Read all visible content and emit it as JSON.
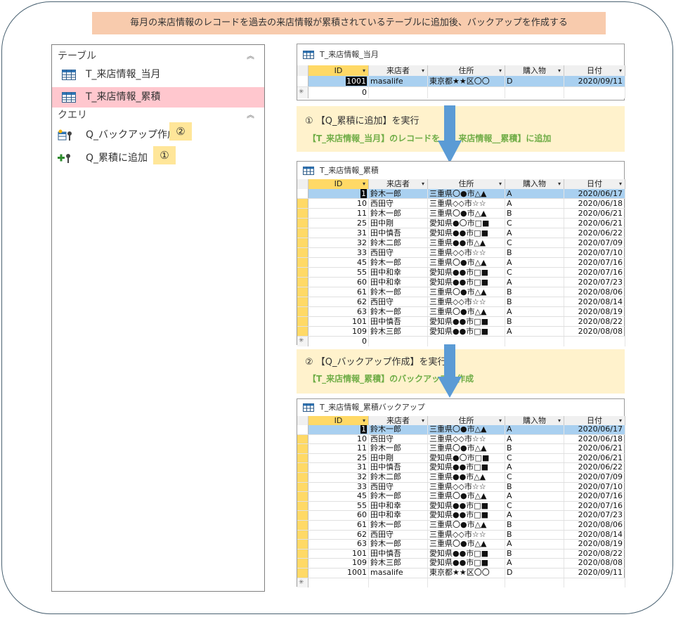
{
  "banner": "毎月の来店情報のレコードを過去の来店情報が累積されているテーブルに追加後、バックアップを作成する",
  "nav": {
    "tables_header": "テーブル",
    "queries_header": "クエリ",
    "collapse_icon": "double-chevron-up",
    "tables": [
      {
        "label": "T_来店情報_当月",
        "icon": "table-icon"
      },
      {
        "label": "T_来店情報_累積",
        "icon": "table-icon",
        "selected": true
      }
    ],
    "queries": [
      {
        "label": "Q_バックアップ作成",
        "icon": "make-table-query-icon",
        "badge": "②"
      },
      {
        "label": "Q_累積に追加",
        "icon": "append-query-icon",
        "badge": "①"
      }
    ]
  },
  "columns": [
    "ID",
    "来店者",
    "住所",
    "購入物",
    "日付"
  ],
  "sheet_monthly": {
    "title": "T_来店情報_当月",
    "rows": [
      {
        "id": "1001",
        "name": "masalife",
        "addr": "東京都★★区〇〇",
        "item": "D",
        "date": "2020/09/11"
      }
    ],
    "new_row_id": "0"
  },
  "step1": {
    "line1": "① 【Q_累積に追加】を実行",
    "line2": "【T_来店情報_当月】のレコードを【T_来店情報__累積】に追加"
  },
  "sheet_cumulative": {
    "title": "T_来店情報_累積",
    "rows": [
      {
        "id": "1",
        "name": "鈴木一郎",
        "addr": "三重県〇●市△▲",
        "item": "A",
        "date": "2020/06/17"
      },
      {
        "id": "10",
        "name": "西田守",
        "addr": "三重県◇◇市☆☆",
        "item": "A",
        "date": "2020/06/18"
      },
      {
        "id": "11",
        "name": "鈴木一郎",
        "addr": "三重県〇●市△▲",
        "item": "B",
        "date": "2020/06/21"
      },
      {
        "id": "25",
        "name": "田中剛",
        "addr": "愛知県●〇市□■",
        "item": "C",
        "date": "2020/06/21"
      },
      {
        "id": "31",
        "name": "田中慎吾",
        "addr": "愛知県●●市□■",
        "item": "A",
        "date": "2020/06/22"
      },
      {
        "id": "32",
        "name": "鈴木二郎",
        "addr": "三重県●●市△▲",
        "item": "C",
        "date": "2020/07/09"
      },
      {
        "id": "33",
        "name": "西田守",
        "addr": "三重県◇◇市☆☆",
        "item": "B",
        "date": "2020/07/10"
      },
      {
        "id": "45",
        "name": "鈴木一郎",
        "addr": "三重県〇●市△▲",
        "item": "A",
        "date": "2020/07/16"
      },
      {
        "id": "55",
        "name": "田中和幸",
        "addr": "愛知県●●市□■",
        "item": "C",
        "date": "2020/07/16"
      },
      {
        "id": "60",
        "name": "田中和幸",
        "addr": "愛知県●●市□■",
        "item": "A",
        "date": "2020/07/23"
      },
      {
        "id": "61",
        "name": "鈴木一郎",
        "addr": "三重県〇●市△▲",
        "item": "B",
        "date": "2020/08/06"
      },
      {
        "id": "62",
        "name": "西田守",
        "addr": "三重県◇◇市☆☆",
        "item": "B",
        "date": "2020/08/14"
      },
      {
        "id": "63",
        "name": "鈴木一郎",
        "addr": "三重県〇●市△▲",
        "item": "A",
        "date": "2020/08/19"
      },
      {
        "id": "101",
        "name": "田中慎吾",
        "addr": "愛知県●●市□■",
        "item": "B",
        "date": "2020/08/22"
      },
      {
        "id": "109",
        "name": "鈴木三郎",
        "addr": "愛知県●●市□■",
        "item": "A",
        "date": "2020/08/08"
      }
    ],
    "new_row_id": "0"
  },
  "step2": {
    "line1": "② 【Q_バックアップ作成】を実行",
    "line2": "【T_来店情報_累積】のバックアップを作成"
  },
  "sheet_backup": {
    "title": "T_来店情報_累積バックアップ",
    "rows": [
      {
        "id": "1",
        "name": "鈴木一郎",
        "addr": "三重県〇●市△▲",
        "item": "A",
        "date": "2020/06/17"
      },
      {
        "id": "10",
        "name": "西田守",
        "addr": "三重県◇◇市☆☆",
        "item": "A",
        "date": "2020/06/18"
      },
      {
        "id": "11",
        "name": "鈴木一郎",
        "addr": "三重県〇●市△▲",
        "item": "B",
        "date": "2020/06/21"
      },
      {
        "id": "25",
        "name": "田中剛",
        "addr": "愛知県●〇市□■",
        "item": "C",
        "date": "2020/06/21"
      },
      {
        "id": "31",
        "name": "田中慎吾",
        "addr": "愛知県●●市□■",
        "item": "A",
        "date": "2020/06/22"
      },
      {
        "id": "32",
        "name": "鈴木二郎",
        "addr": "三重県●●市△▲",
        "item": "C",
        "date": "2020/07/09"
      },
      {
        "id": "33",
        "name": "西田守",
        "addr": "三重県◇◇市☆☆",
        "item": "B",
        "date": "2020/07/10"
      },
      {
        "id": "45",
        "name": "鈴木一郎",
        "addr": "三重県〇●市△▲",
        "item": "A",
        "date": "2020/07/16"
      },
      {
        "id": "55",
        "name": "田中和幸",
        "addr": "愛知県●●市□■",
        "item": "C",
        "date": "2020/07/16"
      },
      {
        "id": "60",
        "name": "田中和幸",
        "addr": "愛知県●●市□■",
        "item": "A",
        "date": "2020/07/23"
      },
      {
        "id": "61",
        "name": "鈴木一郎",
        "addr": "三重県〇●市△▲",
        "item": "B",
        "date": "2020/08/06"
      },
      {
        "id": "62",
        "name": "西田守",
        "addr": "三重県◇◇市☆☆",
        "item": "B",
        "date": "2020/08/14"
      },
      {
        "id": "63",
        "name": "鈴木一郎",
        "addr": "三重県〇●市△▲",
        "item": "A",
        "date": "2020/08/19"
      },
      {
        "id": "101",
        "name": "田中慎吾",
        "addr": "愛知県●●市□■",
        "item": "B",
        "date": "2020/08/22"
      },
      {
        "id": "109",
        "name": "鈴木三郎",
        "addr": "愛知県●●市□■",
        "item": "A",
        "date": "2020/08/08"
      },
      {
        "id": "1001",
        "name": "masalife",
        "addr": "東京都★★区〇〇",
        "item": "D",
        "date": "2020/09/11"
      }
    ],
    "new_row_id": ""
  },
  "colors": {
    "accent_arrow": "#5b9bd5",
    "selected_nav": "#ffc7ce",
    "step_bg": "#fff2cc",
    "step_text": "#70ad47",
    "banner_bg": "#f8cbad",
    "current_row": "#a9d0f0",
    "selector": "#ffd966"
  }
}
